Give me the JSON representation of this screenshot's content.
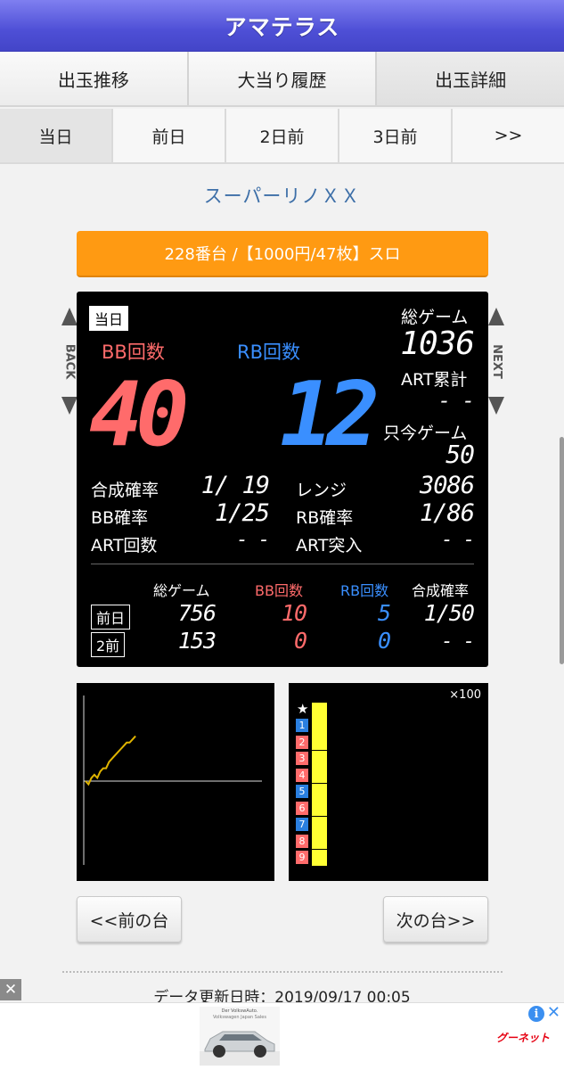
{
  "header": {
    "title": "アマテラス"
  },
  "tabs": [
    {
      "label": "出玉推移"
    },
    {
      "label": "大当り履歴"
    },
    {
      "label": "出玉詳細"
    }
  ],
  "days": [
    {
      "label": "当日"
    },
    {
      "label": "前日"
    },
    {
      "label": "2日前"
    },
    {
      "label": "3日前"
    },
    {
      "label": ">>"
    }
  ],
  "machine": {
    "name": "スーパーリノＸＸ",
    "banner": "228番台 /【1000円/47枚】スロ"
  },
  "nav": {
    "back": "BACK",
    "next": "NEXT"
  },
  "panel": {
    "day_tag": "当日",
    "bb_label": "BB回数",
    "rb_label": "RB回数",
    "bb_count": "40",
    "rb_count": "12",
    "total_games_label": "総ゲーム",
    "total_games": "1036",
    "art_total_label": "ART累計",
    "art_total": "- -",
    "current_games_label": "只今ゲーム",
    "current_games": "50",
    "combined_rate_label": "合成確率",
    "combined_rate": "1/ 19",
    "bb_rate_label": "BB確率",
    "bb_rate": "1/25",
    "art_count_label": "ART回数",
    "art_count": "- -",
    "range_label": "レンジ",
    "range": "3086",
    "rb_rate_label": "RB確率",
    "rb_rate": "1/86",
    "art_entry_label": "ART突入",
    "art_entry": "- -",
    "history_headers": [
      "総ゲーム",
      "BB回数",
      "RB回数",
      "合成確率"
    ],
    "history": [
      {
        "tag": "前日",
        "games": "756",
        "bb": "10",
        "rb": "5",
        "rate": "1/50"
      },
      {
        "tag": "2前",
        "games": "153",
        "bb": "0",
        "rb": "0",
        "rate": "- -"
      }
    ]
  },
  "graph": {
    "points": [
      [
        0,
        0
      ],
      [
        1,
        -1
      ],
      [
        2,
        1
      ],
      [
        3,
        2
      ],
      [
        4,
        1
      ],
      [
        5,
        3
      ],
      [
        6,
        4
      ],
      [
        7,
        4
      ],
      [
        8,
        6
      ],
      [
        9,
        7
      ],
      [
        10,
        8
      ],
      [
        11,
        9
      ],
      [
        12,
        10
      ],
      [
        13,
        11
      ],
      [
        14,
        12
      ],
      [
        15,
        12
      ],
      [
        16,
        13
      ],
      [
        17,
        14
      ]
    ]
  },
  "bar_chart": {
    "scale_label": "×100",
    "star": "★",
    "rows": [
      {
        "n": "1",
        "type": "RB",
        "value": 1
      },
      {
        "n": "2",
        "type": "BB",
        "value": 1
      },
      {
        "n": "3",
        "type": "BB",
        "value": 1
      },
      {
        "n": "4",
        "type": "BB",
        "value": 1
      },
      {
        "n": "5",
        "type": "RB",
        "value": 1
      },
      {
        "n": "6",
        "type": "BB",
        "value": 1
      },
      {
        "n": "7",
        "type": "RB",
        "value": 1
      },
      {
        "n": "8",
        "type": "BB",
        "value": 1
      },
      {
        "n": "9",
        "type": "BB",
        "value": 1
      }
    ],
    "colors": {
      "bb": "#ff6b6b",
      "rb": "#2a7fe0",
      "bar": "#ffff33"
    }
  },
  "buttons": {
    "prev": "<<前の台",
    "next": "次の台>>"
  },
  "footer": {
    "updated": "データ更新日時：2019/09/17 00:05"
  },
  "ad": {
    "close": "✕",
    "info": "i",
    "x": "✕",
    "logo": "グーネット",
    "caption": "Der VolkswAuto.",
    "subcaption": "Volkswagen Japan Sales"
  },
  "colors": {
    "accent": "#ff9a12",
    "header": "#4e4fd6",
    "bb": "#ff6b6b",
    "rb": "#3a8fff"
  }
}
